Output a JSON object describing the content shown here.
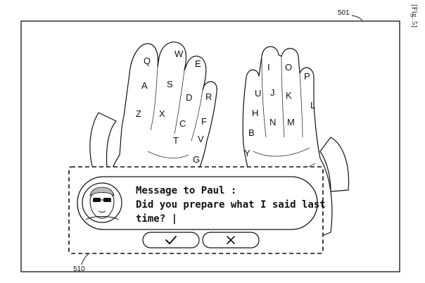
{
  "figure_label": "[Fig. 5]",
  "refs": {
    "screen": "501",
    "popup": "510"
  },
  "left_hand_keys": [
    "Q",
    "W",
    "E",
    "A",
    "S",
    "D",
    "R",
    "Z",
    "X",
    "C",
    "F",
    "T",
    "V",
    "G"
  ],
  "right_hand_keys": [
    "I",
    "O",
    "P",
    "U",
    "J",
    "K",
    "L",
    "H",
    "N",
    "M",
    "B",
    "Y"
  ],
  "message": {
    "line1": "Message to Paul :",
    "line2": "Did you prepare what I said last",
    "line3": "time? |"
  },
  "buttons": {
    "confirm_icon": "check-icon",
    "cancel_icon": "close-icon"
  }
}
